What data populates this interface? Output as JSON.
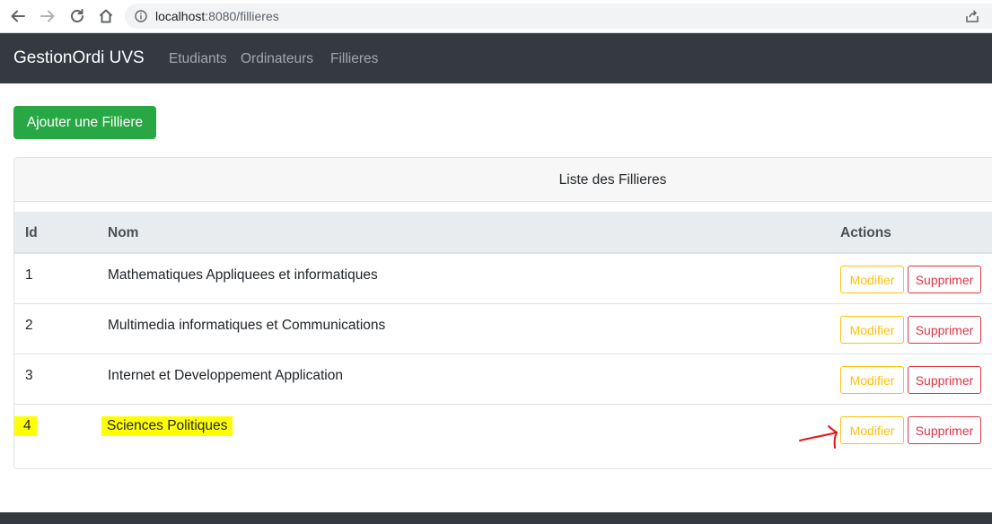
{
  "browser": {
    "url_host": "localhost",
    "url_path": ":8080/fillieres",
    "icons": [
      "back-icon",
      "forward-icon",
      "reload-icon",
      "home-icon",
      "info-icon",
      "share-icon"
    ]
  },
  "navbar": {
    "brand": "GestionOrdi UVS",
    "links": [
      {
        "label": "Etudiants"
      },
      {
        "label": "Ordinateurs"
      },
      {
        "label": "Fillieres"
      }
    ]
  },
  "add_button": {
    "label": "Ajouter une Filliere"
  },
  "card": {
    "title": "Liste des Fillieres",
    "columns": {
      "id": "Id",
      "nom": "Nom",
      "actions": "Actions"
    },
    "rows": [
      {
        "id": "1",
        "nom": "Mathematiques Appliquees et informatiques",
        "modifier": "Modifier",
        "supprimer": "Supprimer"
      },
      {
        "id": "2",
        "nom": "Multimedia informatiques et Communications",
        "modifier": "Modifier",
        "supprimer": "Supprimer"
      },
      {
        "id": "3",
        "nom": "Internet et Developpement Application",
        "modifier": "Modifier",
        "supprimer": "Supprimer"
      },
      {
        "id": "4",
        "nom": "Sciences Politiques",
        "modifier": "Modifier",
        "supprimer": "Supprimer"
      }
    ]
  },
  "colors": {
    "navbar": "#343a40",
    "success": "#28a745",
    "warning": "#ffc107",
    "danger": "#dc3545",
    "highlight": "#ffff00",
    "annotation_arrow": "#e8141a"
  }
}
